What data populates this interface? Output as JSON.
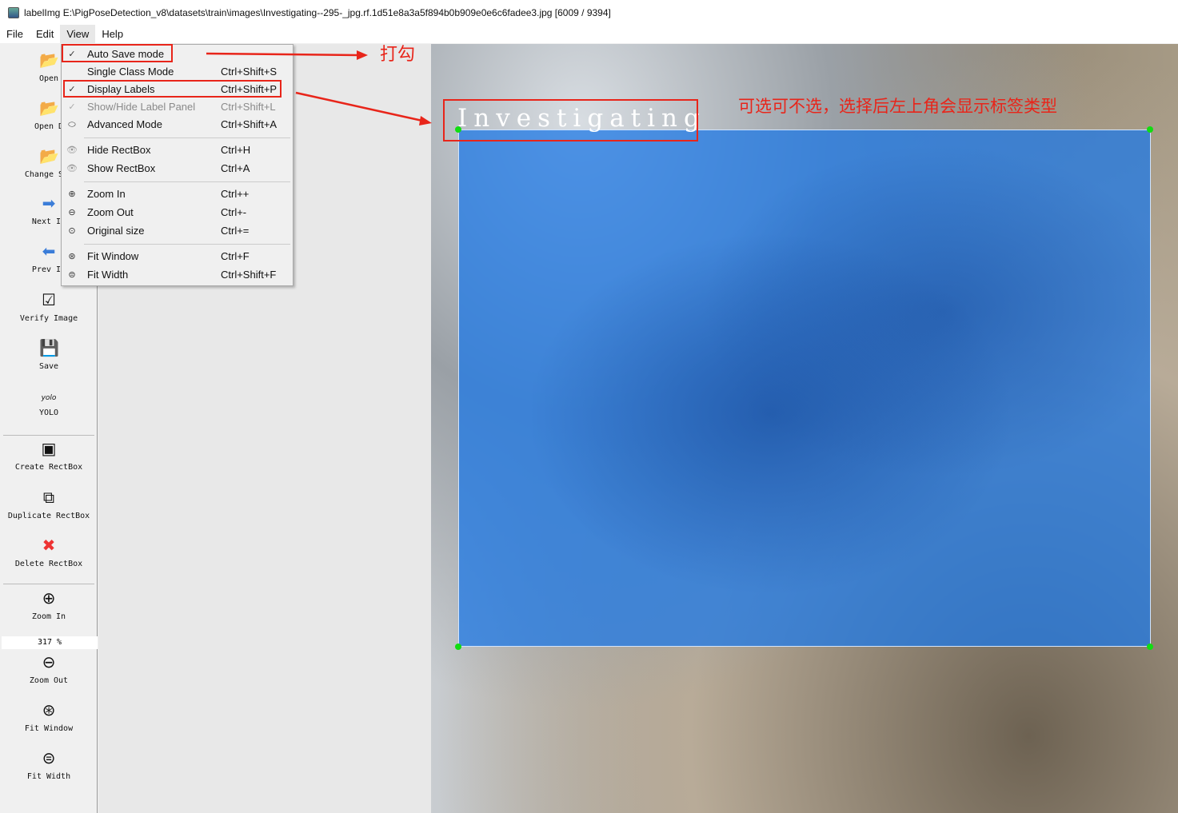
{
  "window": {
    "title": "labelImg E:\\PigPoseDetection_v8\\datasets\\train\\images\\Investigating--295-_jpg.rf.1d51e8a3a5f894b0b909e0e6c6fadee3.jpg [6009 / 9394]"
  },
  "menubar": [
    "File",
    "Edit",
    "View",
    "Help"
  ],
  "toolbar": {
    "open": "Open",
    "open_dir": "Open D",
    "change_save": "Change Sav",
    "next": "Next Im",
    "prev": "Prev Im",
    "verify": "Verify Image",
    "save": "Save",
    "yolo_icon": "yolo",
    "yolo": "YOLO",
    "create": "Create RectBox",
    "duplicate": "Duplicate RectBox",
    "delete": "Delete RectBox",
    "zoom_in": "Zoom In",
    "zoom_value": "317 %",
    "zoom_out": "Zoom Out",
    "fit_window": "Fit Window",
    "fit_width": "Fit Width"
  },
  "view_menu": [
    {
      "label": "Auto Save mode",
      "shortcut": "",
      "checked": true
    },
    {
      "label": "Single Class Mode",
      "shortcut": "Ctrl+Shift+S"
    },
    {
      "label": "Display Labels",
      "shortcut": "Ctrl+Shift+P",
      "checked": true
    },
    {
      "label": "Show/Hide Label Panel",
      "shortcut": "Ctrl+Shift+L",
      "disabled": true
    },
    {
      "label": "Advanced Mode",
      "shortcut": "Ctrl+Shift+A"
    },
    {
      "label": "Hide RectBox",
      "shortcut": "Ctrl+H"
    },
    {
      "label": "Show RectBox",
      "shortcut": "Ctrl+A"
    },
    {
      "label": "Zoom In",
      "shortcut": "Ctrl++"
    },
    {
      "label": "Zoom Out",
      "shortcut": "Ctrl+-"
    },
    {
      "label": "Original size",
      "shortcut": "Ctrl+="
    },
    {
      "label": "Fit Window",
      "shortcut": "Ctrl+F"
    },
    {
      "label": "Fit Width",
      "shortcut": "Ctrl+Shift+F"
    }
  ],
  "canvas": {
    "box_label": "Investigating",
    "box_color": "#1e78e6"
  },
  "annotations": {
    "tick": "打勾",
    "note": "可选可不选，选择后左上角会显示标签类型",
    "color": "#e8251a"
  }
}
